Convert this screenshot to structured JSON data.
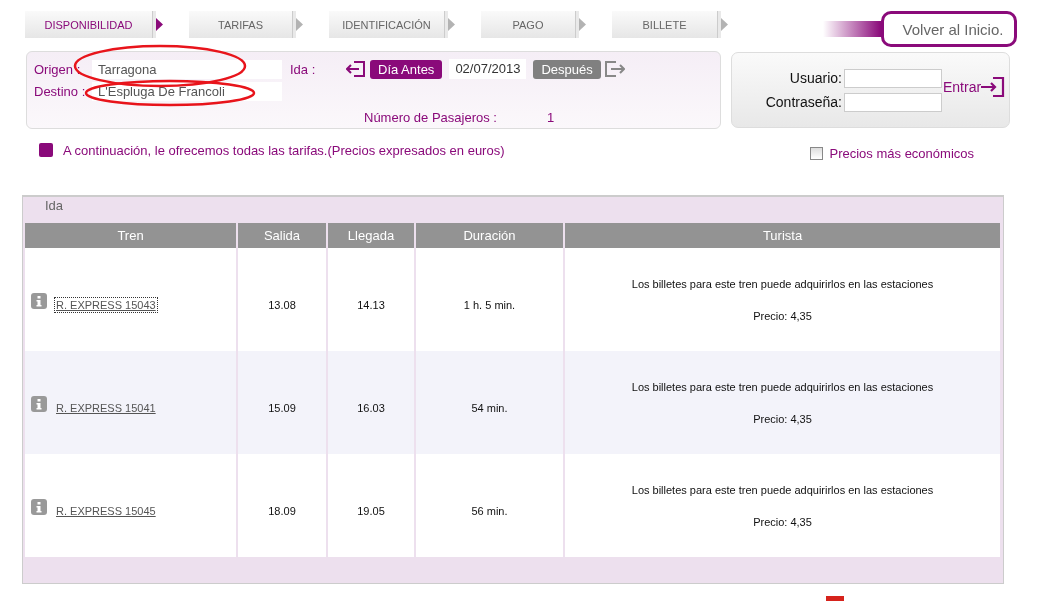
{
  "steps": [
    {
      "label": "DISPONIBILIDAD",
      "selected": true
    },
    {
      "label": "TARIFAS",
      "selected": false
    },
    {
      "label": "IDENTIFICACIÓN",
      "selected": false
    },
    {
      "label": "PAGO",
      "selected": false
    },
    {
      "label": "BILLETE",
      "selected": false
    }
  ],
  "home_button": "Volver al Inicio.",
  "search": {
    "origin_label": "Origen :",
    "origin": "Tarragona",
    "destination_label": "Destino :",
    "destination": "L'Espluga De Francoli",
    "ida_label": "Ida :",
    "prev_day": "Día Antes",
    "date": "02/07/2013",
    "next_day": "Después",
    "passengers_label": "Número de Pasajeros :",
    "passengers": "1"
  },
  "login": {
    "user_label": "Usuario:",
    "password_label": "Contraseña:",
    "submit": "Entrar"
  },
  "notice": "A continuación, le ofrecemos todas las tarifas.(Precios expresados en euros)",
  "cheapest_filter": {
    "label": "Precios más económicos",
    "checked": false
  },
  "table": {
    "title": "Ida",
    "columns": [
      "Tren",
      "Salida",
      "Llegada",
      "Duración",
      "Turista"
    ],
    "rows": [
      {
        "train": "R. EXPRESS 15043",
        "departure": "13.08",
        "arrival": "14.13",
        "duration": "1 h. 5 min.",
        "message": "Los billetes para este tren puede adquirirlos en las estaciones",
        "price": "Precio: 4,35",
        "selected": true
      },
      {
        "train": "R. EXPRESS 15041",
        "departure": "15.09",
        "arrival": "16.03",
        "duration": "54 min.",
        "message": "Los billetes para este tren puede adquirirlos en las estaciones",
        "price": "Precio: 4,35",
        "selected": false
      },
      {
        "train": "R. EXPRESS 15045",
        "departure": "18.09",
        "arrival": "19.05",
        "duration": "56 min.",
        "message": "Los billetes para este tren puede adquirirlos en las estaciones",
        "price": "Precio: 4,35",
        "selected": false
      }
    ]
  }
}
